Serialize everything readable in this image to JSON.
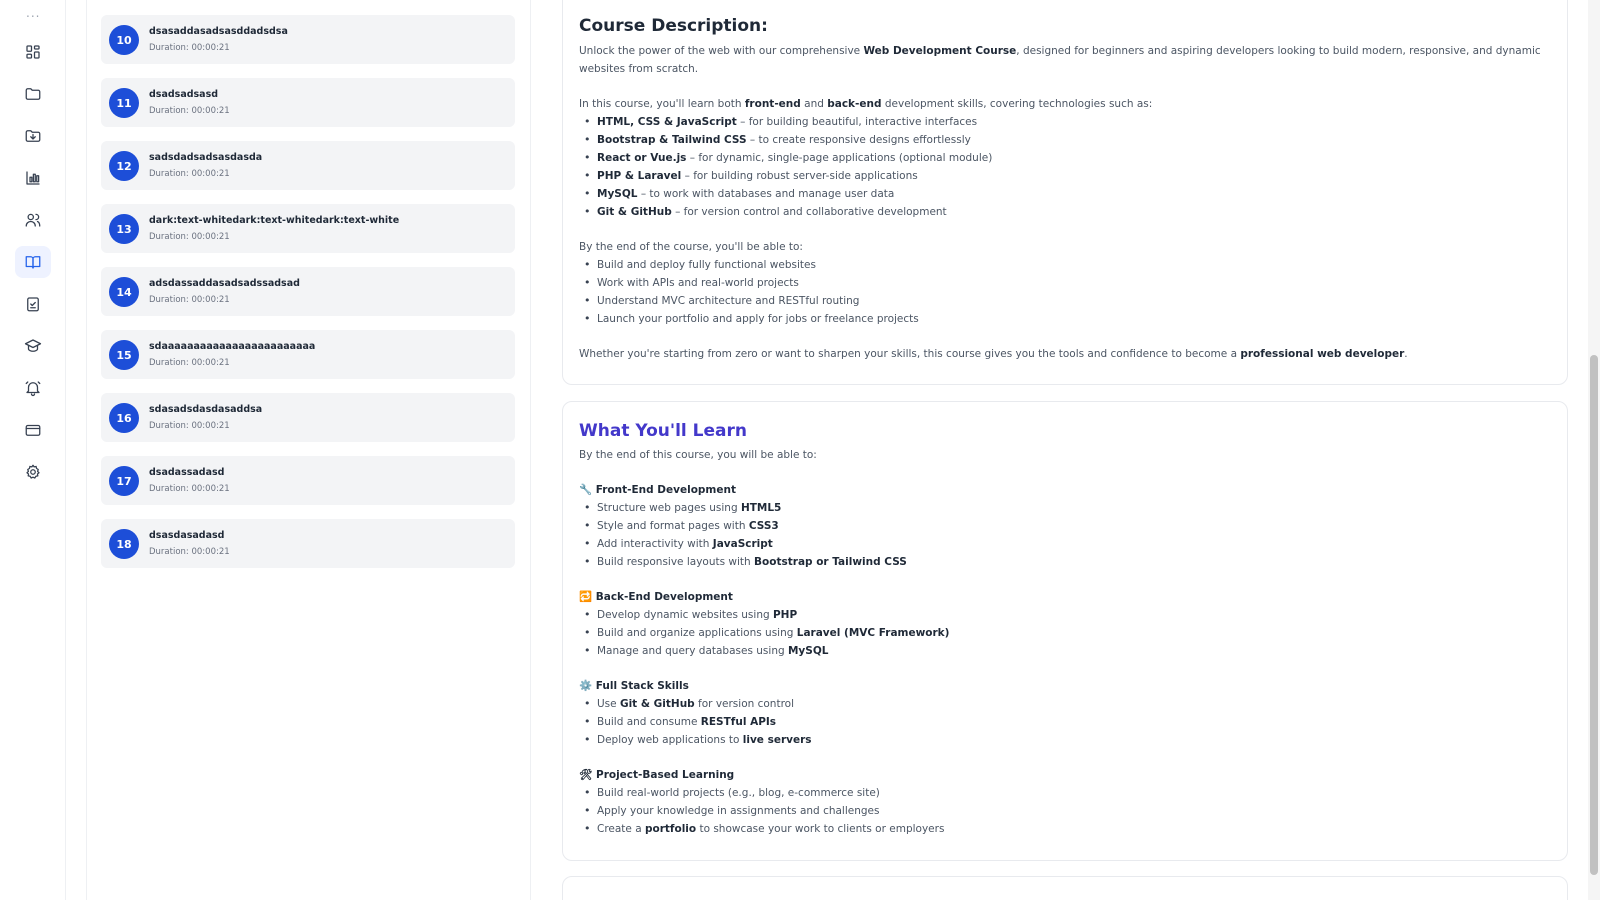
{
  "rail": {
    "dots": "...",
    "items": [
      {
        "icon": "dashboard-grid-icon"
      },
      {
        "icon": "folder-icon"
      },
      {
        "icon": "folder-download-icon"
      },
      {
        "icon": "bar-chart-icon"
      },
      {
        "icon": "users-icon"
      },
      {
        "icon": "open-book-icon",
        "active": true
      },
      {
        "icon": "clipboard-check-icon"
      },
      {
        "icon": "graduation-cap-icon"
      },
      {
        "icon": "bell-icon"
      },
      {
        "icon": "credit-card-icon"
      },
      {
        "icon": "gear-icon"
      }
    ]
  },
  "lessons": [
    {
      "num": "10",
      "title": "dsasaddasadsasddadsdsa",
      "duration": "Duration: 00:00:21"
    },
    {
      "num": "11",
      "title": "dsadsadsasd",
      "duration": "Duration: 00:00:21"
    },
    {
      "num": "12",
      "title": "sadsdadsadsasdasda",
      "duration": "Duration: 00:00:21"
    },
    {
      "num": "13",
      "title": "dark:text-whitedark:text-whitedark:text-white",
      "duration": "Duration: 00:00:21"
    },
    {
      "num": "14",
      "title": "adsdassaddasadsadssadsad",
      "duration": "Duration: 00:00:21"
    },
    {
      "num": "15",
      "title": "sdaaaaaaaaaaaaaaaaaaaaaaaa",
      "duration": "Duration: 00:00:21"
    },
    {
      "num": "16",
      "title": "sdasadsdasdasaddsa",
      "duration": "Duration: 00:00:21"
    },
    {
      "num": "17",
      "title": "dsadassadasd",
      "duration": "Duration: 00:00:21"
    },
    {
      "num": "18",
      "title": "dsasdasadasd",
      "duration": "Duration: 00:00:21"
    }
  ],
  "description": {
    "heading": "Course Description:",
    "intro_a": "Unlock the power of the web with our comprehensive ",
    "intro_b": "Web Development Course",
    "intro_c": ", designed for beginners and aspiring developers looking to build modern, responsive, and dynamic websites from scratch.",
    "skills_a": "In this course, you'll learn both ",
    "skills_b": "front-end",
    "skills_c": " and ",
    "skills_d": "back-end",
    "skills_e": " development skills, covering technologies such as:",
    "tech": [
      {
        "bold": "HTML, CSS & JavaScript",
        "rest": " – for building beautiful, interactive interfaces"
      },
      {
        "bold": "Bootstrap & Tailwind CSS",
        "rest": " – to create responsive designs effortlessly"
      },
      {
        "bold": "React or Vue.js",
        "rest": " – for dynamic, single-page applications (optional module)"
      },
      {
        "bold": "PHP & Laravel",
        "rest": " – for building robust server-side applications"
      },
      {
        "bold": "MySQL",
        "rest": " – to work with databases and manage user data"
      },
      {
        "bold": "Git & GitHub",
        "rest": " – for version control and collaborative development"
      }
    ],
    "outcomes_intro": "By the end of the course, you'll be able to:",
    "outcomes": [
      "Build and deploy fully functional websites",
      "Work with APIs and real-world projects",
      "Understand MVC architecture and RESTful routing",
      "Launch your portfolio and apply for jobs or freelance projects"
    ],
    "closing_a": "Whether you're starting from zero or want to sharpen your skills, this course gives you the tools and confidence to become a ",
    "closing_b": "professional web developer",
    "closing_c": "."
  },
  "learn": {
    "heading": "What You'll Learn",
    "intro": "By the end of this course, you will be able to:",
    "sections": [
      {
        "emoji": "🔧",
        "title": "Front-End Development",
        "items": [
          {
            "pre": "Structure web pages using ",
            "bold": "HTML5",
            "post": ""
          },
          {
            "pre": "Style and format pages with ",
            "bold": "CSS3",
            "post": ""
          },
          {
            "pre": "Add interactivity with ",
            "bold": "JavaScript",
            "post": ""
          },
          {
            "pre": "Build responsive layouts with ",
            "bold": "Bootstrap or Tailwind CSS",
            "post": ""
          }
        ]
      },
      {
        "emoji": "🔁",
        "title": "Back-End Development",
        "items": [
          {
            "pre": "Develop dynamic websites using ",
            "bold": "PHP",
            "post": ""
          },
          {
            "pre": "Build and organize applications using ",
            "bold": "Laravel (MVC Framework)",
            "post": ""
          },
          {
            "pre": "Manage and query databases using ",
            "bold": "MySQL",
            "post": ""
          }
        ]
      },
      {
        "emoji": "⚙️",
        "title": "Full Stack Skills",
        "items": [
          {
            "pre": "Use ",
            "bold": "Git & GitHub",
            "post": " for version control"
          },
          {
            "pre": "Build and consume ",
            "bold": "RESTful APIs",
            "post": ""
          },
          {
            "pre": "Deploy web applications to ",
            "bold": "live servers",
            "post": ""
          }
        ]
      },
      {
        "emoji": "🛠",
        "title": "Project-Based Learning",
        "items": [
          {
            "pre": "Build real-world projects (e.g., blog, e-commerce site)",
            "bold": "",
            "post": ""
          },
          {
            "pre": "Apply your knowledge in assignments and challenges",
            "bold": "",
            "post": ""
          },
          {
            "pre": "Create a ",
            "bold": "portfolio",
            "post": " to showcase your work to clients or employers"
          }
        ]
      }
    ]
  },
  "colors": {
    "accent": "#1d4ed8",
    "heading_purple": "#4338ca"
  }
}
